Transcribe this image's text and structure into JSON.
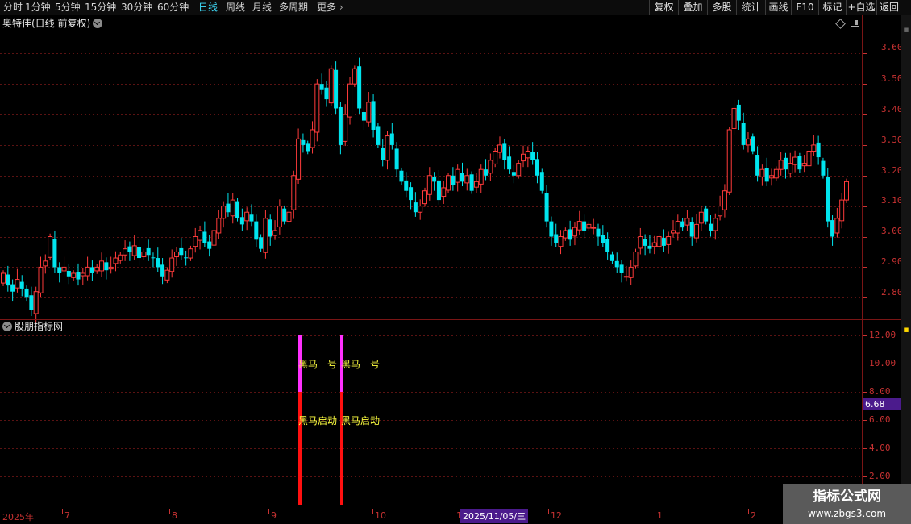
{
  "toolbar": {
    "periods": [
      "分时",
      "1分钟",
      "5分钟",
      "15分钟",
      "30分钟",
      "60分钟",
      "日线",
      "周线",
      "月线",
      "多周期",
      "更多"
    ],
    "active_period": "日线",
    "right_buttons": [
      "复权",
      "叠加",
      "多股",
      "统计",
      "画线",
      "F10",
      "标记",
      "+自选",
      "返回"
    ]
  },
  "main_panel": {
    "title": "奥特佳(日线 前复权)",
    "y_ticks": [
      "3.60",
      "3.50",
      "3.40",
      "3.30",
      "3.20",
      "3.10",
      "3.00",
      "2.90",
      "2.80"
    ]
  },
  "indicator_panel": {
    "title": "股朋指标网",
    "y_ticks": [
      "12.00",
      "10.00",
      "8.00",
      "6.00",
      "4.00",
      "2.00"
    ],
    "current_value": "6.68",
    "signal_top_label": "黑马一号",
    "signal_bottom_label": "黑马启动"
  },
  "date_axis": {
    "labels": [
      "2025年",
      "7",
      "8",
      "9",
      "10",
      "11",
      "12",
      "1",
      "2"
    ],
    "current_date": "2025/11/05/三"
  },
  "watermark": {
    "line1": "指标公式网",
    "line2": "www.zbgs3.com"
  },
  "colors": {
    "up": "#ff3b3b",
    "down": "#00e5ee",
    "signal_magenta": "#ff30ff",
    "signal_red": "#ff1010",
    "axis_red": "#c83232",
    "highlight_purple": "#4b1b8c"
  },
  "chart_data": {
    "type": "candlestick",
    "ylim": [
      2.74,
      3.68
    ],
    "y_ticks": [
      2.8,
      2.9,
      3.0,
      3.1,
      3.2,
      3.3,
      3.4,
      3.5,
      3.6
    ],
    "closes": [
      2.88,
      2.84,
      2.82,
      2.86,
      2.83,
      2.8,
      2.76,
      2.82,
      2.9,
      2.92,
      3.0,
      2.9,
      2.88,
      2.9,
      2.87,
      2.88,
      2.86,
      2.88,
      2.9,
      2.88,
      2.9,
      2.92,
      2.89,
      2.9,
      2.93,
      2.94,
      2.96,
      2.95,
      2.97,
      2.93,
      2.95,
      2.94,
      2.93,
      2.9,
      2.87,
      2.89,
      2.93,
      2.95,
      2.94,
      2.93,
      2.96,
      3.0,
      3.02,
      2.98,
      2.96,
      3.02,
      3.06,
      3.1,
      3.08,
      3.12,
      3.06,
      3.04,
      3.08,
      3.05,
      2.99,
      2.96,
      3.06,
      3.0,
      3.02,
      3.1,
      3.05,
      3.08,
      3.2,
      3.32,
      3.3,
      3.28,
      3.35,
      3.5,
      3.48,
      3.45,
      3.55,
      3.42,
      3.3,
      3.4,
      3.5,
      3.55,
      3.42,
      3.38,
      3.44,
      3.35,
      3.3,
      3.25,
      3.33,
      3.3,
      3.22,
      3.18,
      3.15,
      3.12,
      3.08,
      3.1,
      3.15,
      3.2,
      3.18,
      3.12,
      3.16,
      3.2,
      3.17,
      3.22,
      3.18,
      3.2,
      3.15,
      3.18,
      3.22,
      3.2,
      3.25,
      3.28,
      3.3,
      3.25,
      3.22,
      3.2,
      3.24,
      3.27,
      3.28,
      3.25,
      3.2,
      3.15,
      3.05,
      3.0,
      2.98,
      3.0,
      3.02,
      2.99,
      3.03,
      3.05,
      3.02,
      3.04,
      3.03,
      3.0,
      2.98,
      2.95,
      2.92,
      2.9,
      2.88,
      2.87,
      2.9,
      2.95,
      3.0,
      2.97,
      2.96,
      2.98,
      3.0,
      2.97,
      3.0,
      3.02,
      3.05,
      3.03,
      3.06,
      3.0,
      3.04,
      3.08,
      3.05,
      3.02,
      3.06,
      3.1,
      3.15,
      3.35,
      3.42,
      3.38,
      3.3,
      3.32,
      3.28,
      3.2,
      3.22,
      3.18,
      3.2,
      3.22,
      3.25,
      3.22,
      3.24,
      3.26,
      3.22,
      3.24,
      3.28,
      3.3,
      3.26,
      3.2,
      3.05,
      3.0,
      3.06,
      3.12,
      3.18
    ]
  }
}
